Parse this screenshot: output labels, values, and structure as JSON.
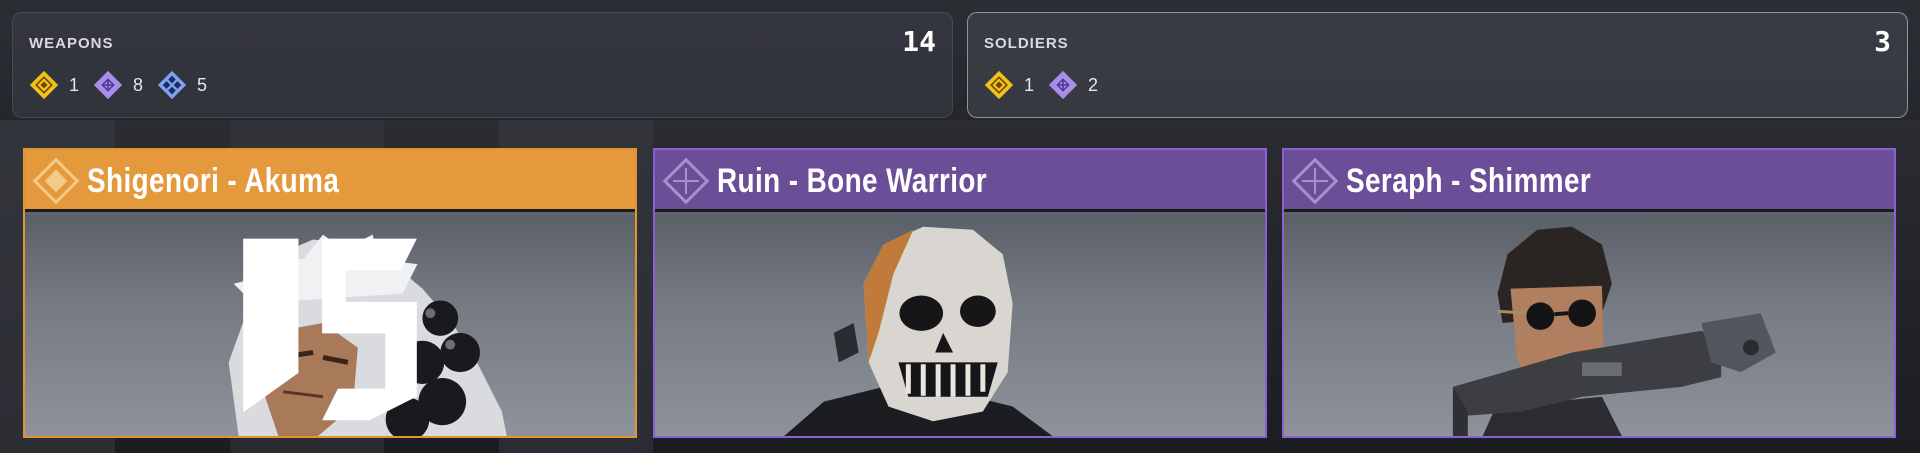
{
  "summary": {
    "weapons": {
      "label": "WEAPONS",
      "total": "14",
      "counts": [
        {
          "icon": "rarity-legendary-icon",
          "color": "#f2c21a",
          "value": "1"
        },
        {
          "icon": "rarity-epic-icon",
          "color": "#a88ee8",
          "value": "8"
        },
        {
          "icon": "rarity-rare-icon",
          "color": "#7fa2f0",
          "value": "5"
        }
      ]
    },
    "soldiers": {
      "label": "SOLDIERS",
      "total": "3",
      "counts": [
        {
          "icon": "rarity-legendary-icon",
          "color": "#f2c21a",
          "value": "1"
        },
        {
          "icon": "rarity-epic-icon",
          "color": "#a88ee8",
          "value": "2"
        }
      ]
    }
  },
  "cards": [
    {
      "title": "Shigenori - Akuma",
      "rarity": "legendary",
      "color": "#e49a3c"
    },
    {
      "title": "Ruin - Bone Warrior",
      "rarity": "epic",
      "color": "#6b4e98"
    },
    {
      "title": "Seraph - Shimmer",
      "rarity": "epic",
      "color": "#6b4e98"
    }
  ]
}
